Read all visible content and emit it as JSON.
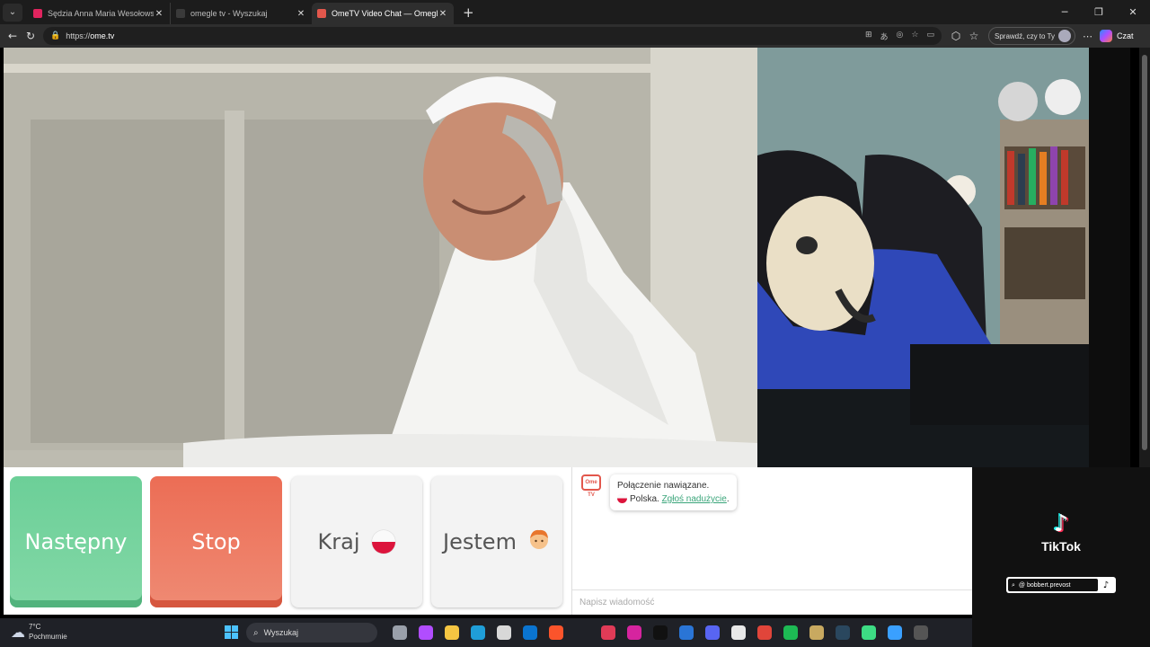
{
  "browser": {
    "tabs": [
      {
        "title": "Sędzia Anna Maria Wesołowska o",
        "favicon_color": "#e0245e",
        "active": false
      },
      {
        "title": "omegle tv - Wyszukaj",
        "favicon_color": "#2b2b2b",
        "active": false
      },
      {
        "title": "OmeTV Video Chat — Omegle",
        "favicon_color": "#e2574c",
        "active": true
      }
    ],
    "url_scheme": "https://",
    "url_host": "ome.tv",
    "check_pill_label": "Sprawdź, czy to Ty",
    "copilot_label": "Czat"
  },
  "controls": {
    "next_label": "Następny",
    "stop_label": "Stop",
    "country_label": "Kraj",
    "gender_label": "Jestem",
    "gender_icon": "boy-emoji-icon",
    "colors": {
      "next": "#6ccf98",
      "stop": "#ec6d55"
    }
  },
  "chat": {
    "logo_text": "Ome TV",
    "connected_text": "Połączenie nawiązane.",
    "country_text": "Polska.",
    "report_link": "Zgłoś nadużycie",
    "report_suffix": ".",
    "input_placeholder": "Napisz wiadomość"
  },
  "tiktok": {
    "brand": "TikTok",
    "handle": "@ bobbert.prevost"
  },
  "taskbar": {
    "temperature": "7°C",
    "weather_text": "Pochmurnie",
    "search_label": "Wyszukaj",
    "pinned_icons": [
      {
        "name": "task-view-icon",
        "color": "#9aa0aa"
      },
      {
        "name": "copilot-icon",
        "color": "#b14dff"
      },
      {
        "name": "file-explorer-icon",
        "color": "#f4c542"
      },
      {
        "name": "edge-icon",
        "color": "#1f9ed8"
      },
      {
        "name": "store-icon",
        "color": "#d8d8d8"
      },
      {
        "name": "outlook-icon",
        "color": "#0a74d0"
      },
      {
        "name": "brave-icon",
        "color": "#fb542b"
      },
      {
        "name": "spacer",
        "color": "transparent"
      },
      {
        "name": "wykop-icon",
        "color": "#e03b57"
      },
      {
        "name": "instagram-icon",
        "color": "#d6249f"
      },
      {
        "name": "tiktok-icon",
        "color": "#111111"
      },
      {
        "name": "taskbar-app-icon",
        "color": "#2a75d6"
      },
      {
        "name": "discord-icon",
        "color": "#5865f2"
      },
      {
        "name": "unreal-icon",
        "color": "#e8e8e8"
      },
      {
        "name": "game-icon",
        "color": "#e1453a"
      },
      {
        "name": "spotify-icon",
        "color": "#1db954"
      },
      {
        "name": "league-icon",
        "color": "#c8a960"
      },
      {
        "name": "steam-icon",
        "color": "#2a475e"
      },
      {
        "name": "android-icon",
        "color": "#3ddc84"
      },
      {
        "name": "power-icon",
        "color": "#3aa0ff"
      },
      {
        "name": "terminal-icon",
        "color": "#555555"
      }
    ]
  }
}
